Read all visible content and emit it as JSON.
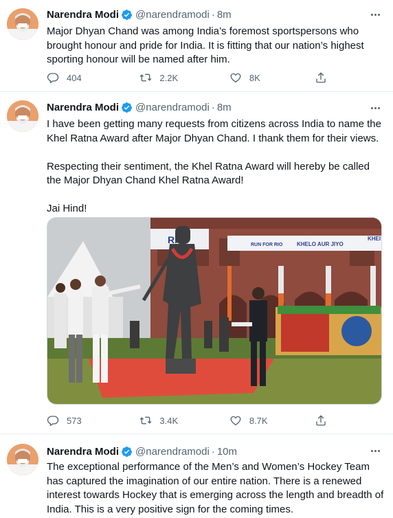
{
  "tweets": [
    {
      "author": {
        "name": "Narendra Modi",
        "handle": "@narendramodi"
      },
      "time": "8m",
      "text": "Major Dhyan Chand was among India’s foremost sportspersons who brought honour and pride for India. It is fitting that our nation’s highest sporting honour will be named after him.",
      "stats": {
        "replies": "404",
        "retweets": "2.2K",
        "likes": "8K"
      }
    },
    {
      "author": {
        "name": "Narendra Modi",
        "handle": "@narendramodi"
      },
      "time": "8m",
      "text": "I have been getting many requests from citizens across India to name the Khel Ratna Award after Major Dhyan Chand. I thank them for their views.\n\nRespecting their sentiment,  the Khel Ratna Award will hereby be called the Major Dhyan Chand Khel Ratna Award!\n\nJai Hind!",
      "photo": {
        "banner_left": "RUN FOR RIO",
        "banner_right": "KHELO AUR JIYO",
        "banner_edge": "KHEI",
        "banner_top": "RIO"
      },
      "stats": {
        "replies": "573",
        "retweets": "3.4K",
        "likes": "8.7K"
      }
    },
    {
      "author": {
        "name": "Narendra Modi",
        "handle": "@narendramodi"
      },
      "time": "10m",
      "text": "The exceptional performance of the Men’s and Women’s Hockey Team has captured the imagination of our entire nation. There is a renewed interest towards Hockey that is emerging across the length and breadth of India. This is a very positive sign for the coming times."
    }
  ],
  "colors": {
    "text": "#0f1419",
    "secondary": "#536471",
    "verified": "#1d9bf0",
    "divider": "#e6ecf0"
  },
  "icons": [
    "reply-icon",
    "retweet-icon",
    "like-icon",
    "share-icon",
    "verified-icon",
    "more-icon"
  ]
}
